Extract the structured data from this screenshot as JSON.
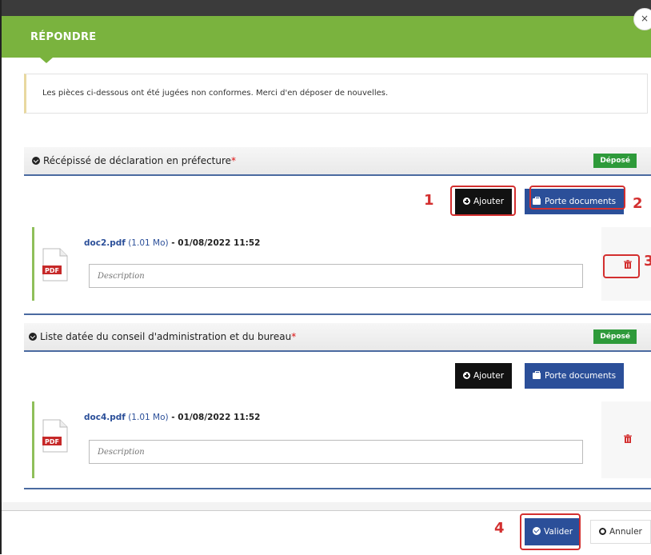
{
  "modal": {
    "title": "RÉPONDRE",
    "close_glyph": "×",
    "notice": "Les pièces ci-dessous ont été jugées non conformes. Merci d'en déposer de nouvelles."
  },
  "sections": [
    {
      "title": "Récépissé de déclaration en préfecture",
      "required_mark": "*",
      "status": "Déposé",
      "add_label": "Ajouter",
      "portfolio_label": "Porte documents",
      "document": {
        "filename": "doc2.pdf",
        "size": "(1.01 Mo)",
        "separator": " - ",
        "date": "01/08/2022 11:52",
        "file_type": "PDF",
        "description_placeholder": "Description"
      }
    },
    {
      "title": "Liste datée du conseil d'administration et du bureau",
      "required_mark": "*",
      "status": "Déposé",
      "add_label": "Ajouter",
      "portfolio_label": "Porte documents",
      "document": {
        "filename": "doc4.pdf",
        "size": "(1.01 Mo)",
        "separator": " - ",
        "date": "01/08/2022 11:52",
        "file_type": "PDF",
        "description_placeholder": "Description"
      }
    }
  ],
  "footer": {
    "validate_label": "Valider",
    "cancel_label": "Annuler"
  },
  "annotations": [
    "1",
    "2",
    "3",
    "4"
  ],
  "colors": {
    "header_green": "#7ab33e",
    "status_green": "#2e9a3a",
    "primary_blue": "#2b4f99",
    "annotation_red": "#d32f2f",
    "delete_red": "#d32f2f"
  },
  "icons": {
    "add": "plus-circle-icon",
    "portfolio": "briefcase-icon",
    "delete": "trash-icon",
    "file": "pdf-file-icon",
    "validate": "check-circle-icon",
    "cancel": "circle-icon",
    "section": "check-circle-icon"
  }
}
